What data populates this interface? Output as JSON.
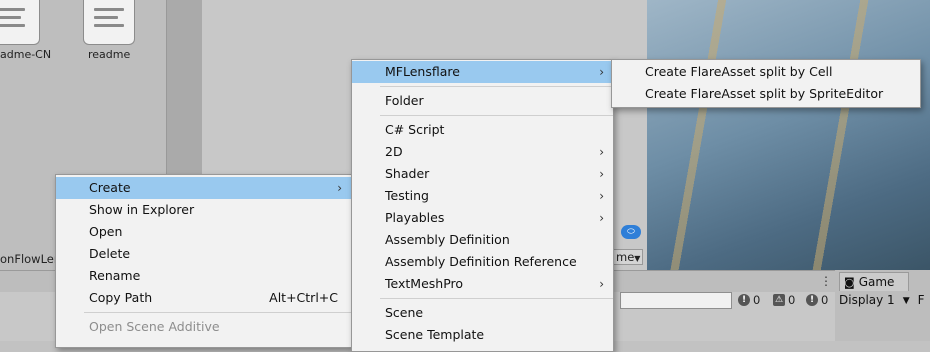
{
  "project": {
    "files": [
      {
        "label": "adme-CN"
      },
      {
        "label": "readme"
      }
    ],
    "bottom_item": "onFlowLen"
  },
  "scene": {
    "tab_partial": "me"
  },
  "console": {
    "counters": {
      "info": "0",
      "warnings": "0",
      "errors": "0"
    }
  },
  "game": {
    "tab_label": "Game",
    "display_label": "Display 1",
    "display_arrow": "▼",
    "extra": "F"
  },
  "context_menu": {
    "items": [
      {
        "label": "Create",
        "arrow": "›"
      },
      {
        "label": "Show in Explorer"
      },
      {
        "label": "Open"
      },
      {
        "label": "Delete"
      },
      {
        "label": "Rename"
      },
      {
        "label": "Copy Path",
        "shortcut": "Alt+Ctrl+C"
      },
      {
        "label": "Open Scene Additive"
      }
    ]
  },
  "create_menu": {
    "items": [
      {
        "label": "MFLensflare",
        "arrow": "›"
      },
      {
        "label": "Folder"
      },
      {
        "label": "C# Script"
      },
      {
        "label": "2D",
        "arrow": "›"
      },
      {
        "label": "Shader",
        "arrow": "›"
      },
      {
        "label": "Testing",
        "arrow": "›"
      },
      {
        "label": "Playables",
        "arrow": "›"
      },
      {
        "label": "Assembly Definition"
      },
      {
        "label": "Assembly Definition Reference"
      },
      {
        "label": "TextMeshPro",
        "arrow": "›"
      },
      {
        "label": "Scene"
      },
      {
        "label": "Scene Template"
      }
    ]
  },
  "mflensflare_menu": {
    "items": [
      {
        "label": "Create FlareAsset split by Cell"
      },
      {
        "label": "Create FlareAsset split by SpriteEditor"
      }
    ]
  },
  "colors": {
    "highlight": "#99c9ef",
    "menu_bg": "#f2f2f2",
    "disabled_text": "#8d8d8d"
  }
}
